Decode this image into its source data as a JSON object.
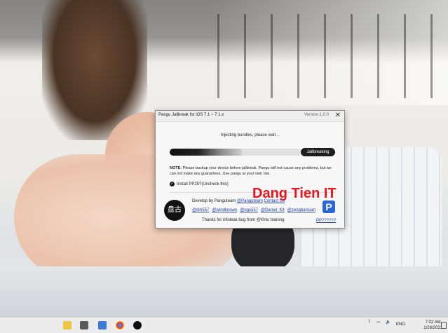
{
  "dialog": {
    "title": "Pangu Jailbreak for iOS 7.1 ~ 7.1.x",
    "version": "Version:1.0.0",
    "close_glyph": "✕",
    "status": "Injecting bundles, please wait ..",
    "progress_fraction": 0.55,
    "jailbreak_button": "Jailbreaking",
    "note_label": "NOTE:",
    "note_text": "Please backup your device before jailbreak. Pangu will not cause any problems, but we can not make any guarantees. Use pangu at your own risk.",
    "install_option": "Install PP25?(Uncheck this)",
    "install_checked": true,
    "develop_by": "Develop by Panguteam",
    "develop_links": [
      "@Panguteam",
      "Contact Us"
    ],
    "team_links": [
      "@dm557",
      "@windknown",
      "@ogc557",
      "@Daniel_K4",
      "@zengbanxian"
    ],
    "thanks": "Thanks for infoleak bug from @i0nic training",
    "pp_link": "PP??????",
    "logo_text": "盘古"
  },
  "watermark": "Dang Tien IT",
  "taskbar": {
    "language": "ENG",
    "time": "7:02 AM",
    "date": "1/28/2021"
  },
  "colors": {
    "watermark": "#e8141e",
    "link": "#1f3fae",
    "pp_brand": "#2a68d8"
  }
}
